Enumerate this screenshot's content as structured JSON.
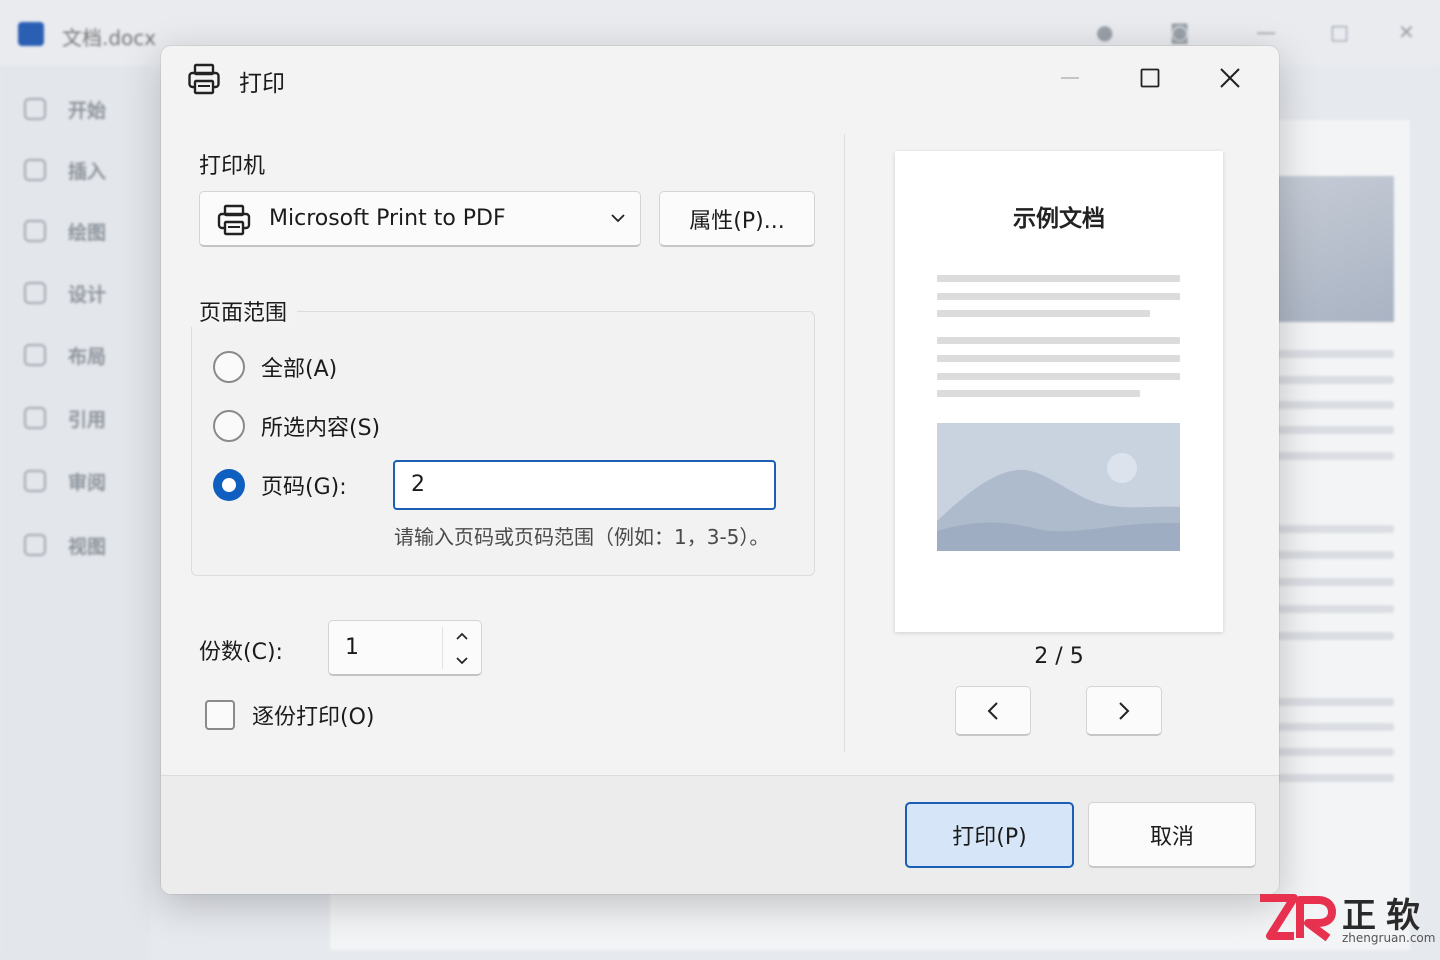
{
  "background_app": {
    "title": "文档.docx",
    "nav_items": [
      "开始",
      "插入",
      "绘图",
      "设计",
      "布局",
      "引用",
      "审阅",
      "视图"
    ]
  },
  "dialog": {
    "title": "打印",
    "title_icon": "printer-icon",
    "controls": {
      "minimize": "minimize-icon",
      "maximize": "maximize-icon",
      "close": "close-icon"
    }
  },
  "printer": {
    "label": "打印机",
    "selected": "Microsoft Print to PDF",
    "properties_button": "属性(P)..."
  },
  "page_range": {
    "legend": "页面范围",
    "options": [
      {
        "label": "全部(A)",
        "selected": false
      },
      {
        "label": "所选内容(S)",
        "selected": false
      },
      {
        "label": "页码(G):",
        "selected": true
      }
    ],
    "pages_value": "2",
    "hint": "请输入页码或页码范围（例如：1，3-5）。"
  },
  "copies": {
    "label": "份数(C):",
    "value": "1"
  },
  "collate": {
    "label": "逐份打印(O)",
    "checked": false
  },
  "preview": {
    "doc_title": "示例文档",
    "page_indicator": "2 / 5",
    "current_page": 2,
    "total_pages": 5
  },
  "footer": {
    "print_button": "打印(P)",
    "cancel_button": "取消"
  },
  "watermark": {
    "logo_text": "ZR",
    "name": "正软",
    "domain": "zhengruan.com"
  },
  "colors": {
    "accent": "#1a5fb4",
    "radio_selected": "#0f5fc0",
    "primary_button_bg": "#d6e6f8",
    "watermark_logo": "#e8304f",
    "dialog_bg": "#f3f3f3"
  }
}
